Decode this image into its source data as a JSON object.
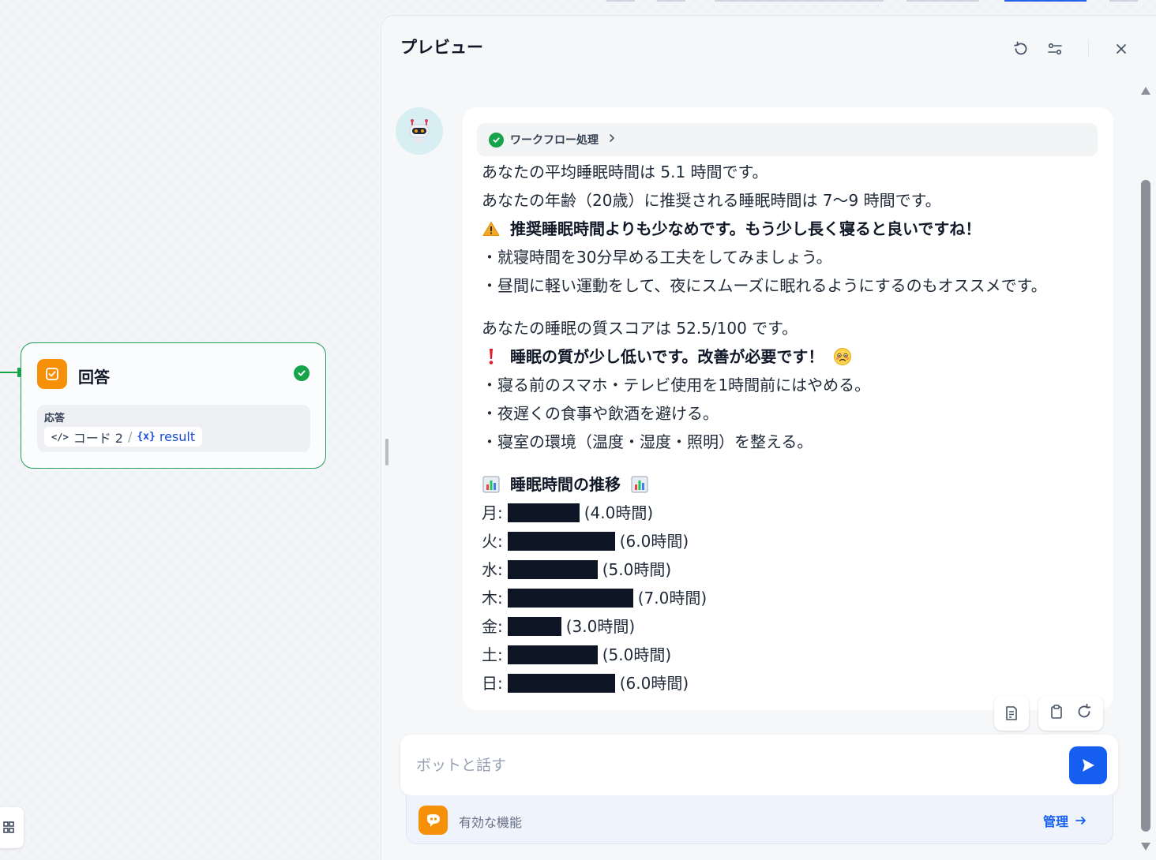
{
  "node": {
    "title": "回答",
    "field_label": "応答",
    "chip_source": "コード 2",
    "chip_separator": "/",
    "chip_variable": "result",
    "icons": {
      "node": "answer-icon",
      "status": "check-circle-icon",
      "code": "code-icon",
      "variable": "variable-icon"
    }
  },
  "panel": {
    "title": "プレビュー",
    "header_icons": [
      "restart-icon",
      "settings-sliders-icon",
      "close-icon"
    ]
  },
  "bot": {
    "avatar_icon": "robot-avatar-icon"
  },
  "workflow": {
    "label": "ワークフロー処理",
    "status_icon": "check-circle-icon"
  },
  "message": {
    "line1": "あなたの平均睡眠時間は 5.1 時間です。",
    "line2": "あなたの年齢（20歳）に推奨される睡眠時間は 7〜9 時間です。",
    "warning": "推奨睡眠時間よりも少なめです。もう少し長く寝ると良いですね！",
    "tip1": "・就寝時間を30分早める工夫をしてみましょう。",
    "tip2": "・昼間に軽い運動をして、夜にスムーズに眠れるようにするのもオススメです。",
    "quality": "あなたの睡眠の質スコアは 52.5/100 です。",
    "alert": "睡眠の質が少し低いです。改善が必要です！",
    "advice1": "・寝る前のスマホ・テレビ使用を1時間前にはやめる。",
    "advice2": "・夜遅くの食事や飲酒を避ける。",
    "advice3": "・寝室の環境（温度・湿度・照明）を整える。",
    "chart_title": "睡眠時間の推移",
    "emoji": {
      "warning": "warning-icon",
      "alert": "exclamation-icon",
      "sad": "worried-face-icon",
      "chart": "bar-chart-icon"
    }
  },
  "chart_data": {
    "type": "bar",
    "title": "睡眠時間の推移",
    "categories": [
      "月",
      "火",
      "水",
      "木",
      "金",
      "土",
      "日"
    ],
    "values": [
      4.0,
      6.0,
      5.0,
      7.0,
      3.0,
      5.0,
      6.0
    ],
    "value_labels": [
      "(4.0時間)",
      "(6.0時間)",
      "(5.0時間)",
      "(7.0時間)",
      "(3.0時間)",
      "(5.0時間)",
      "(6.0時間)"
    ],
    "bar_color": "#0d1524"
  },
  "actions": {
    "icons": [
      "document-icon",
      "clipboard-icon",
      "regenerate-icon"
    ]
  },
  "input": {
    "placeholder": "ボットと話す",
    "value": "",
    "send_icon": "send-icon"
  },
  "features": {
    "label": "有効な機能",
    "manage_label": "管理",
    "icon": "quote-icon",
    "arrow_icon": "arrow-right-icon"
  },
  "colors": {
    "accent": "#155eef",
    "success": "#16a34a",
    "node_orange": "#f79009"
  }
}
